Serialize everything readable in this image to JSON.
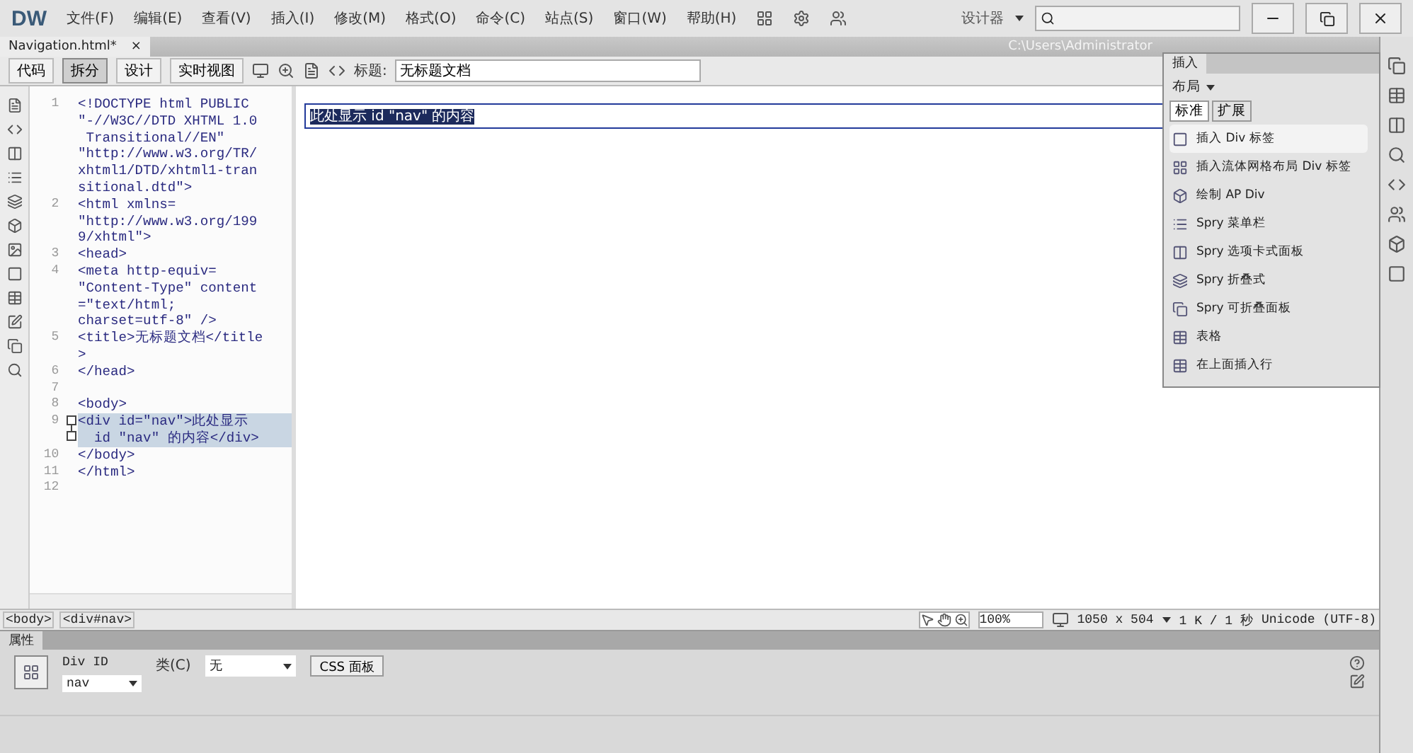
{
  "app": {
    "logo": "DW",
    "menus": [
      "文件(F)",
      "编辑(E)",
      "查看(V)",
      "插入(I)",
      "修改(M)",
      "格式(O)",
      "命令(C)",
      "站点(S)",
      "窗口(W)",
      "帮助(H)"
    ],
    "workspace": "设计器"
  },
  "document": {
    "tab": "Navigation.html*",
    "close": "×",
    "path": "C:\\Users\\Administrator"
  },
  "toolbar": {
    "views": [
      {
        "label": "代码",
        "selected": false
      },
      {
        "label": "拆分",
        "selected": true
      },
      {
        "label": "设计",
        "selected": false
      },
      {
        "label": "实时视图",
        "selected": false
      }
    ],
    "title_label": "标题:",
    "title_value": "无标题文档"
  },
  "code": {
    "lines": [
      {
        "number": "1",
        "rows": [
          "<!DOCTYPE html PUBLIC",
          "\"-//W3C//DTD XHTML 1.0",
          " Transitional//EN\"",
          "\"http://www.w3.org/TR/",
          "xhtml1/DTD/xhtml1-tran",
          "sitional.dtd\">"
        ],
        "selected": false,
        "fold": false
      },
      {
        "number": "2",
        "rows": [
          "<html xmlns=",
          "\"http://www.w3.org/199",
          "9/xhtml\">"
        ],
        "selected": false,
        "fold": false
      },
      {
        "number": "3",
        "rows": [
          "<head>"
        ],
        "selected": false,
        "fold": false
      },
      {
        "number": "4",
        "rows": [
          "<meta http-equiv=",
          "\"Content-Type\" content",
          "=\"text/html;",
          "charset=utf-8\" />"
        ],
        "selected": false,
        "fold": false
      },
      {
        "number": "5",
        "rows": [
          "<title>无标题文档</title",
          ">"
        ],
        "selected": false,
        "fold": false
      },
      {
        "number": "6",
        "rows": [
          "</head>"
        ],
        "selected": false,
        "fold": false
      },
      {
        "number": "7",
        "rows": [
          ""
        ],
        "selected": false,
        "fold": false
      },
      {
        "number": "8",
        "rows": [
          "<body>"
        ],
        "selected": false,
        "fold": false
      },
      {
        "number": "9",
        "rows": [
          "<div id=\"nav\">此处显示",
          "  id \"nav\" 的内容</div>"
        ],
        "selected": true,
        "fold": true
      },
      {
        "number": "10",
        "rows": [
          "</body>"
        ],
        "selected": false,
        "fold": false
      },
      {
        "number": "11",
        "rows": [
          "</html>"
        ],
        "selected": false,
        "fold": false
      },
      {
        "number": "12",
        "rows": [
          ""
        ],
        "selected": false,
        "fold": false
      }
    ]
  },
  "design": {
    "content": "此处显示 id \"nav\" 的内容",
    "selected": true
  },
  "insert_panel": {
    "tab": "插入",
    "category": "布局",
    "subtabs": [
      {
        "label": "标准",
        "selected": true
      },
      {
        "label": "扩展",
        "selected": false
      }
    ],
    "items": [
      {
        "label": "插入 Div 标签",
        "selected": true
      },
      {
        "label": "插入流体网格布局 Div 标签",
        "selected": false
      },
      {
        "label": "绘制 AP Div",
        "selected": false
      },
      {
        "label": "Spry 菜单栏",
        "selected": false
      },
      {
        "label": "Spry 选项卡式面板",
        "selected": false
      },
      {
        "label": "Spry 折叠式",
        "selected": false
      },
      {
        "label": "Spry 可折叠面板",
        "selected": false
      },
      {
        "label": "表格",
        "selected": false
      },
      {
        "label": "在上面插入行",
        "selected": false
      }
    ]
  },
  "tag_selector": [
    "<body>",
    "<div#nav>"
  ],
  "status": {
    "zoom": "100%",
    "size": "1050 x 504",
    "download": "1 K / 1 秒",
    "encoding": "Unicode (UTF-8)"
  },
  "properties": {
    "tab": "属性",
    "div_id_label": "Div ID",
    "div_id_value": "nav",
    "class_label": "类(C)",
    "class_value": "无",
    "css_button": "CSS 面板"
  }
}
